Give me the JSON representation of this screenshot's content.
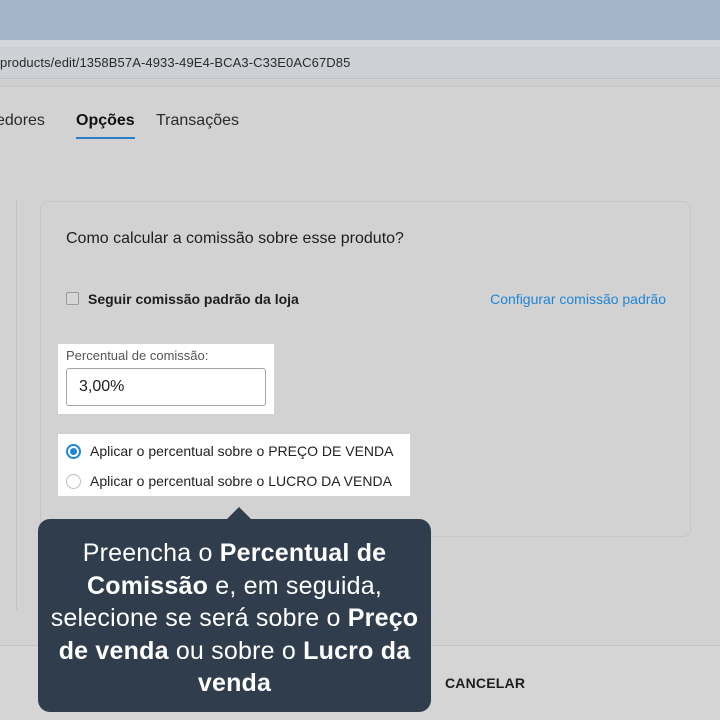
{
  "browser": {
    "url": "products/edit/1358B57A-4933-49E4-BCA3-C33E0AC67D85"
  },
  "tabs": [
    {
      "label": "cedores"
    },
    {
      "label": "Opções",
      "active": true
    },
    {
      "label": "Transações"
    }
  ],
  "commission": {
    "title": "Como calcular a comissão sobre esse produto?",
    "follow_default_label": "Seguir comissão padrão da loja",
    "follow_default_checked": false,
    "config_link": "Configurar comissão padrão",
    "percent_label": "Percentual de comissão",
    "percent_label_suffix": ":",
    "percent_value": "3,00%",
    "options": [
      {
        "label": "Aplicar o percentual sobre o PREÇO DE VENDA",
        "selected": true
      },
      {
        "label": "Aplicar o percentual sobre o LUCRO DA VENDA",
        "selected": false
      }
    ]
  },
  "footer": {
    "cancel_label": "CANCELAR"
  },
  "tooltip": {
    "part1": "Preencha o ",
    "part2": "Percentual de Comissão",
    "part3": " e, em seguida, selecione se será sobre o ",
    "part4": "Preço de venda",
    "part5": " ou sobre o ",
    "part6": "Lucro da venda"
  },
  "colors": {
    "accent": "#1f86d6",
    "tooltip_bg": "#2f3d4d"
  }
}
